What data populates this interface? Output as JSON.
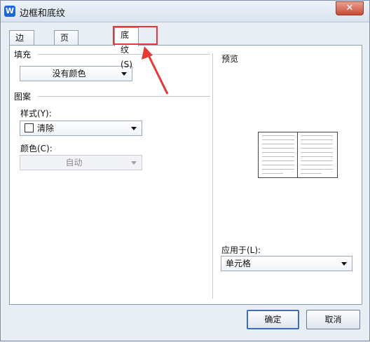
{
  "window": {
    "title": "边框和底纹",
    "close_glyph": "✕",
    "app_icon_glyph": "W"
  },
  "tabs": [
    {
      "label": "边框(B)",
      "active": false
    },
    {
      "label": "页面边框(P)",
      "active": false
    },
    {
      "label": "底纹(S)",
      "active": true
    }
  ],
  "fill": {
    "section_label": "填充",
    "dropdown_value": "没有颜色"
  },
  "pattern": {
    "section_label": "图案",
    "style_label": "样式(Y):",
    "style_value": "清除",
    "color_label": "颜色(C):",
    "color_value": "自动"
  },
  "preview": {
    "label": "预览"
  },
  "apply": {
    "label": "应用于(L):",
    "value": "单元格"
  },
  "buttons": {
    "ok": "确定",
    "cancel": "取消"
  },
  "colors": {
    "highlight": "#e53935",
    "accent": "#1e66d8"
  }
}
